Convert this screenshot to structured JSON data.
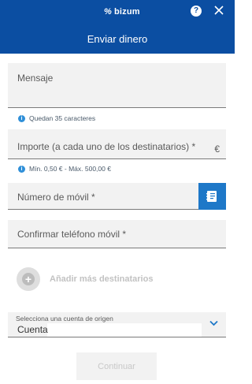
{
  "header": {
    "brand_text": "bizum",
    "brand_mark": "%",
    "help_label": "?",
    "title": "Enviar dinero"
  },
  "form": {
    "message": {
      "label": "Mensaje",
      "hint": "Quedan 35 caracteres"
    },
    "amount": {
      "label": "Importe (a cada uno de los destinatarios) *",
      "currency": "€",
      "hint": "Mín. 0,50 € - Máx. 500,00 €"
    },
    "mobile": {
      "label": "Número de móvil *"
    },
    "confirm_mobile": {
      "label": "Confirmar teléfono móvil *"
    },
    "add_recipients": {
      "label": "Añadir más destinatarios",
      "icon": "+"
    },
    "source_account": {
      "label": "Selecciona una cuenta de origen",
      "value": "Cuenta"
    },
    "continue_label": "Continuar"
  },
  "colors": {
    "header_bg": "#0b4ea2",
    "field_bg": "#f2f2f2",
    "info_icon": "#2f8fd8",
    "contact_button": "#1e78c8"
  },
  "icons": [
    "bizum-logo-icon",
    "help-icon",
    "close-icon",
    "info-icon",
    "contact-book-icon",
    "add-circle-icon",
    "chevron-down-icon"
  ]
}
